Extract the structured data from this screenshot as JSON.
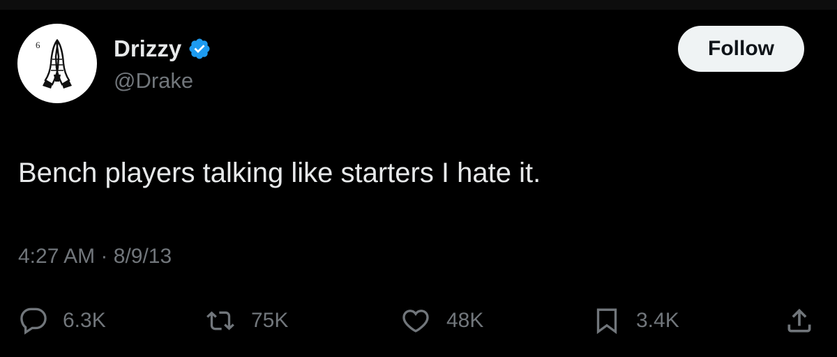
{
  "author": {
    "display_name": "Drizzy",
    "handle": "@Drake",
    "verified": true,
    "avatar_badge": "6"
  },
  "follow_button": {
    "label": "Follow"
  },
  "tweet": {
    "text": "Bench players talking like starters I hate it.",
    "time": "4:27 AM",
    "separator": "·",
    "date": "8/9/13"
  },
  "actions": {
    "replies": "6.3K",
    "reposts": "75K",
    "likes": "48K",
    "bookmarks": "3.4K"
  },
  "colors": {
    "background": "#000000",
    "primary_text": "#e7e9ea",
    "secondary_text": "#71767b",
    "verified_blue": "#1d9bf0",
    "follow_bg": "#eff3f4"
  },
  "icons": {
    "reply": "reply-icon",
    "repost": "repost-icon",
    "like": "heart-icon",
    "bookmark": "bookmark-icon",
    "share": "share-icon",
    "verified": "verified-badge-icon"
  }
}
